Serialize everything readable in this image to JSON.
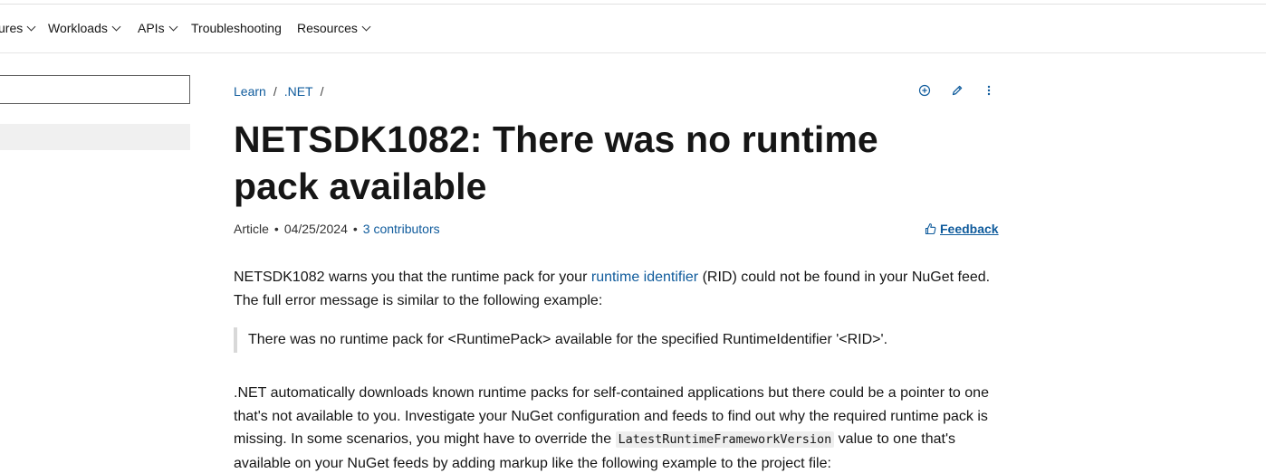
{
  "nav": {
    "items": [
      {
        "label": "ures",
        "has_menu": true
      },
      {
        "label": "Workloads",
        "has_menu": true
      },
      {
        "label": "APIs",
        "has_menu": true
      },
      {
        "label": "Troubleshooting",
        "has_menu": false
      },
      {
        "label": "Resources",
        "has_menu": true
      }
    ]
  },
  "sidebar": {
    "search_value": "",
    "search_placeholder": ""
  },
  "breadcrumb": {
    "items": [
      "Learn",
      ".NET"
    ],
    "separator": "/"
  },
  "actions": {
    "icons": [
      "add-circle-icon",
      "edit-pencil-icon",
      "more-vertical-icon"
    ]
  },
  "article": {
    "title": "NETSDK1082: There was no runtime pack available",
    "meta_type": "Article",
    "meta_date": "04/25/2024",
    "meta_contributors": "3 contributors",
    "meta_separator": "•",
    "feedback_label": "Feedback",
    "p1_before_link": "NETSDK1082 warns you that the runtime pack for your ",
    "p1_link": "runtime identifier",
    "p1_after_link": " (RID) could not be found in your NuGet feed. The full error message is similar to the following example:",
    "quote": "There was no runtime pack for <RuntimePack> available for the specified RuntimeIdentifier '<RID>'.",
    "p2_before_code": ".NET automatically downloads known runtime packs for self-contained applications but there could be a pointer to one that's not available to you. Investigate your NuGet configuration and feeds to find out why the required runtime pack is missing. In some scenarios, you might have to override the ",
    "p2_code": "LatestRuntimeFrameworkVersion",
    "p2_after_code": " value to one that's available on your NuGet feeds by adding markup like the following example to the project file:"
  },
  "colors": {
    "link": "#0f5b9c",
    "text": "#161616",
    "quote_border": "#d8d8d8",
    "code_bg": "#eeeeee",
    "sidebar_highlight": "#f0f0f0"
  }
}
